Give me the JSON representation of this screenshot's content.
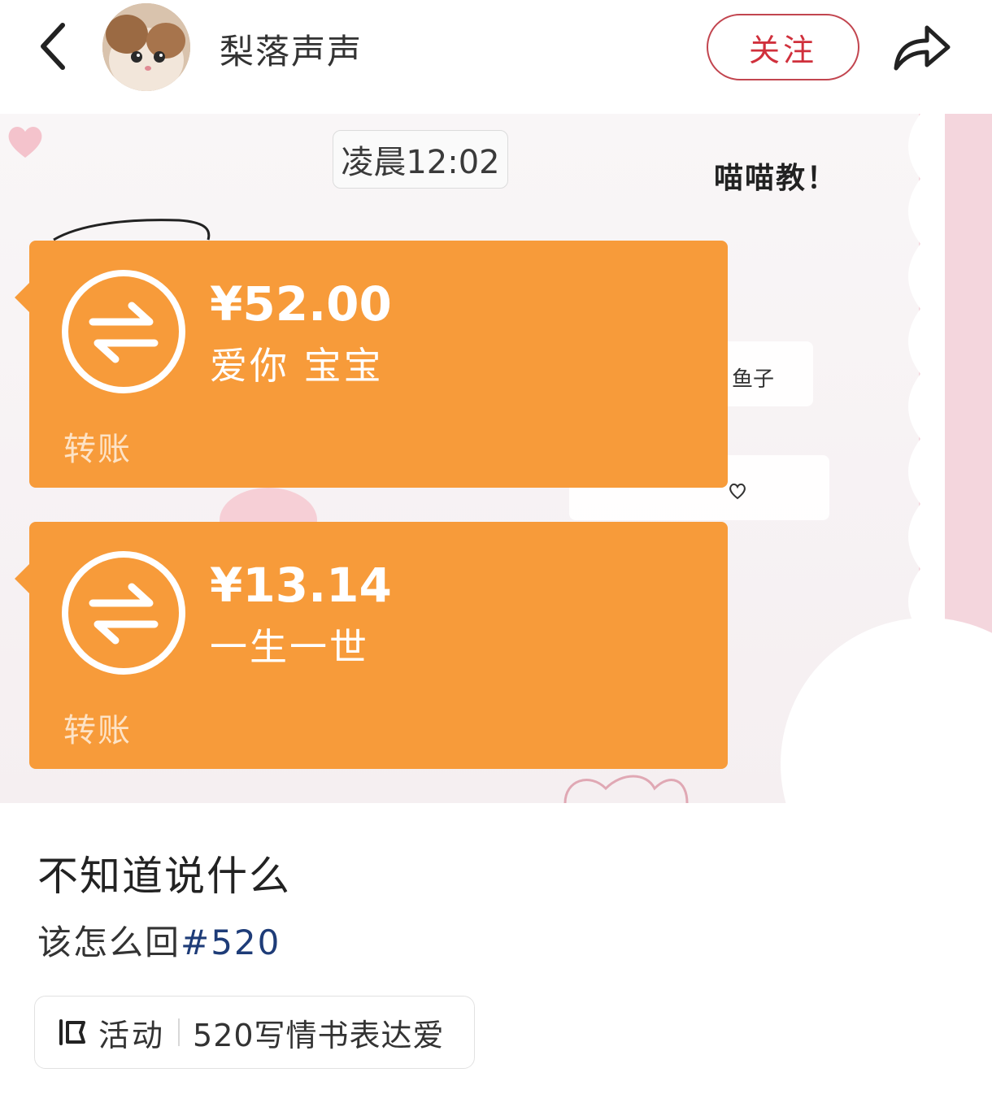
{
  "header": {
    "author_name": "梨落声声",
    "follow_label": "关注"
  },
  "image": {
    "time": "凌晨12:02",
    "sticker_text": "喵喵教！",
    "card_text": "鱼子",
    "transfers": [
      {
        "amount": "¥52.00",
        "note": "爱你 宝宝",
        "label": "转账"
      },
      {
        "amount": "¥13.14",
        "note": "一生一世",
        "label": "转账"
      }
    ]
  },
  "post": {
    "title": "不知道说什么",
    "body_text": "该怎么回",
    "hashtag": "#520"
  },
  "activity": {
    "label": "活动",
    "title": "520写情书表达爱"
  },
  "colors": {
    "transfer_orange": "#f79b3a",
    "follow_red": "#d0303c",
    "hashtag_blue": "#1e3c78"
  }
}
